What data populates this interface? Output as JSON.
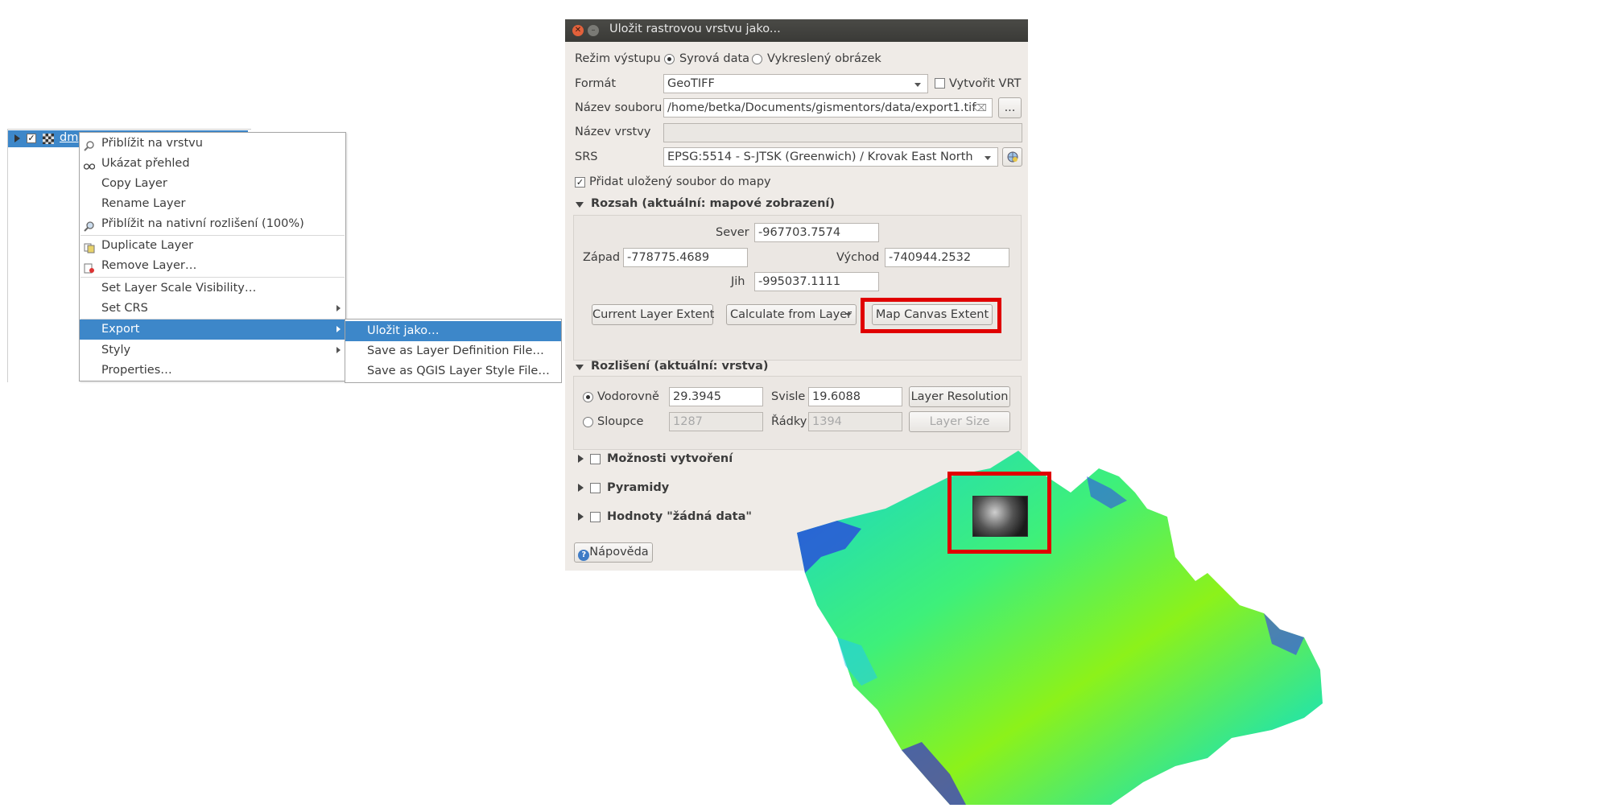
{
  "layer_panel": {
    "layer_name": "dm"
  },
  "context_menu": {
    "items": [
      {
        "label": "Přiblížit na vrstvu",
        "icon": "zoom-icon"
      },
      {
        "label": "Ukázat přehled",
        "icon": "overview-icon"
      },
      {
        "label": "Copy Layer"
      },
      {
        "label": "Rename Layer"
      },
      {
        "label": "Přiblížit na nativní rozlišení (100%)",
        "icon": "zoom-native-icon"
      },
      {
        "label": "Duplicate Layer",
        "icon": "duplicate-icon"
      },
      {
        "label": "Remove Layer…",
        "icon": "remove-icon"
      },
      {
        "label": "Set Layer Scale Visibility…"
      },
      {
        "label": "Set CRS"
      },
      {
        "label": "Export"
      },
      {
        "label": "Styly"
      },
      {
        "label": "Properties…"
      }
    ],
    "submenu": [
      {
        "label": "Uložit jako…"
      },
      {
        "label": "Save as Layer Definition File…"
      },
      {
        "label": "Save as QGIS Layer Style File…"
      }
    ]
  },
  "dialog": {
    "title": "Uložit rastrovou vrstvu jako...",
    "output_mode": {
      "label": "Režim výstupu",
      "opt_raw": "Syrová data",
      "opt_rendered": "Vykreslený obrázek",
      "selected": "raw"
    },
    "format": {
      "label": "Formát",
      "value": "GeoTIFF",
      "vrt_label": "Vytvořit VRT"
    },
    "filename": {
      "label": "Název souboru",
      "value": "/home/betka/Documents/gismentors/data/export1.tif",
      "browse": "..."
    },
    "layer_name": {
      "label": "Název vrstvy",
      "value": ""
    },
    "srs": {
      "label": "SRS",
      "value": "EPSG:5514 - S-JTSK (Greenwich) / Krovak East North"
    },
    "add_to_map": {
      "label": "Přidat uložený soubor do mapy",
      "checked": true
    },
    "extent": {
      "header": "Rozsah (aktuální: mapové zobrazení)",
      "north_label": "Sever",
      "north": "-967703.7574",
      "west_label": "Západ",
      "west": "-778775.4689",
      "east_label": "Východ",
      "east": "-740944.2532",
      "south_label": "Jih",
      "south": "-995037.1111",
      "btn_current": "Current Layer Extent",
      "btn_calc": "Calculate from Layer",
      "btn_canvas": "Map Canvas Extent"
    },
    "resolution": {
      "header": "Rozlišení (aktuální: vrstva)",
      "horiz_label": "Vodorovně",
      "horiz": "29.3945",
      "vert_label": "Svisle",
      "vert": "19.6088",
      "btn_layer_res": "Layer Resolution",
      "cols_label": "Sloupce",
      "cols": "1287",
      "rows_label": "Řádky",
      "rows": "1394",
      "btn_layer_size": "Layer Size"
    },
    "options": [
      {
        "label": "Možnosti vytvoření"
      },
      {
        "label": "Pyramidy"
      },
      {
        "label": "Hodnoty \"žádná data\""
      }
    ],
    "help_label": "Nápověda"
  },
  "colors": {
    "highlight": "#e00000",
    "menu_selection": "#3d87c9",
    "dialog_bg": "#efebe7"
  }
}
